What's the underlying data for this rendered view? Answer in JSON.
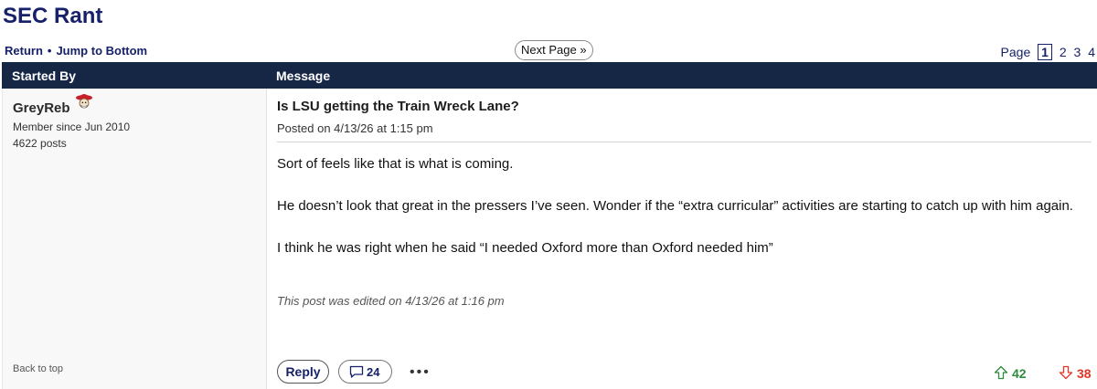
{
  "board": {
    "title": "SEC Rant"
  },
  "nav": {
    "return_label": "Return",
    "separator": "•",
    "jump_label": "Jump to Bottom",
    "next_page": "Next Page »"
  },
  "pager": {
    "label": "Page",
    "pages": [
      "1",
      "2",
      "3",
      "4"
    ],
    "current": "1"
  },
  "table_header": {
    "col1": "Started By",
    "col2": "Message"
  },
  "author": {
    "username": "GreyReb",
    "avatar_icon": "rebel-mascot-icon",
    "member_since": "Member since Jun 2010",
    "posts": "4622 posts",
    "back_to_top": "Back to top"
  },
  "post": {
    "title": "Is LSU getting the Train Wreck Lane?",
    "posted": "Posted on 4/13/26 at 1:15 pm",
    "paragraphs": [
      "Sort of feels like that is what is coming.",
      "He doesn’t look that great in the pressers I’ve seen. Wonder if the “extra curricular” activities are starting to catch up with him again.",
      "I think he was right when he said “I needed Oxford more than Oxford needed him”"
    ],
    "edited": "This post was edited on 4/13/26 at 1:16 pm"
  },
  "actions": {
    "reply_label": "Reply",
    "comment_count": "24",
    "more_label": "•••",
    "upvotes": "42",
    "downvotes": "38"
  },
  "colors": {
    "navy": "#16216a",
    "header_bg": "#162746",
    "up": "#2e8b3b",
    "down": "#e53426"
  }
}
